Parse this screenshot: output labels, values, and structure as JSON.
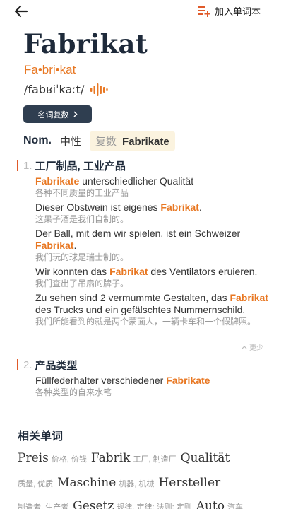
{
  "header": {
    "add_vocab_label": "加入单词本",
    "accent_color": "#e05a2a"
  },
  "entry": {
    "headword": "Fabrikat",
    "syllabification": "Fa•bri•kat",
    "ipa": "/fabʁiˈkaːt/",
    "plural_button": "名词复数"
  },
  "grammar": {
    "case": "Nom.",
    "gender": "中性",
    "plural_label": "复数",
    "plural_form": "Fabrikate"
  },
  "senses": [
    {
      "num": "1.",
      "definition": "工厂制品, 工业产品",
      "examples": [
        {
          "pre": "",
          "hl": "Fabrikate",
          "post": " unterschiedlicher Qualität",
          "zh": "各种不同质量的工业产品"
        },
        {
          "pre": "Dieser Obstwein ist eigenes ",
          "hl": "Fabrikat",
          "post": ".",
          "zh": "这果子酒是我们自制的。"
        },
        {
          "pre": "Der Ball, mit dem wir spielen, ist ein Schweizer ",
          "hl": "Fabrikat",
          "post": ".",
          "zh": "我们玩的球是瑞士制的。"
        },
        {
          "pre": "Wir konnten das ",
          "hl": "Fabrikat",
          "post": " des Ventilators eruieren.",
          "zh": "我们查出了吊扇的牌子。"
        },
        {
          "pre": "Zu sehen sind 2 vermummte Gestalten, das ",
          "hl": "Fabrikat",
          "post": " des Trucks und ein gefälschtes Nummernschild.",
          "zh": "我们所能看到的就是两个蒙面人，一辆卡车和一个假牌照。"
        }
      ],
      "more": "更少"
    },
    {
      "num": "2.",
      "definition": "产品类型",
      "examples": [
        {
          "pre": "Füllfederhalter verschiedener ",
          "hl": "Fabrikate",
          "post": "",
          "zh": "各种类型的自来水笔"
        }
      ]
    }
  ],
  "related": {
    "title": "相关单词",
    "rows": [
      [
        {
          "word": "Preis",
          "gloss": "价格, 价钱"
        },
        {
          "word": "Fabrik",
          "gloss": "工厂, 制造厂"
        },
        {
          "word": "Qualität",
          "gloss": ""
        }
      ],
      [
        {
          "word": "",
          "gloss": "质量, 优质"
        },
        {
          "word": "Maschine",
          "gloss": "机器, 机械"
        },
        {
          "word": "Hersteller",
          "gloss": ""
        }
      ],
      [
        {
          "word": "",
          "gloss": "制造者, 生产者"
        },
        {
          "word": "Gesetz",
          "gloss": "规律, 定律; 法则; 定则"
        },
        {
          "word": "Auto",
          "gloss": "汽车"
        }
      ]
    ]
  }
}
